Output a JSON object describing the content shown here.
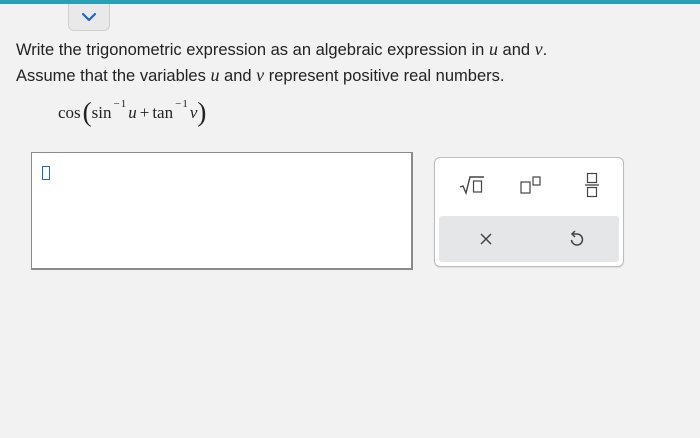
{
  "question": {
    "line1_prefix": "Write the trigonometric expression as an algebraic expression in",
    "var_u": "u",
    "and": "and",
    "var_v": "v",
    "period": ".",
    "line2_prefix": "Assume that the variables",
    "line2_suffix": "represent positive real numbers."
  },
  "expression": {
    "cos": "cos",
    "open_paren": "(",
    "sin": "sin",
    "inv1": "−1",
    "u": "u",
    "plus": "+",
    "tan": "tan",
    "inv2": "−1",
    "v": "v",
    "close_paren": ")"
  },
  "answer": {
    "value": ""
  },
  "palette": {
    "buttons": [
      "sqrt-template",
      "exponent-template",
      "fraction-template",
      "clear",
      "undo"
    ]
  },
  "colors": {
    "top_strip": "#2aa0b7",
    "placeholder_border": "#1a67c9",
    "chevron": "#1a67c9"
  }
}
